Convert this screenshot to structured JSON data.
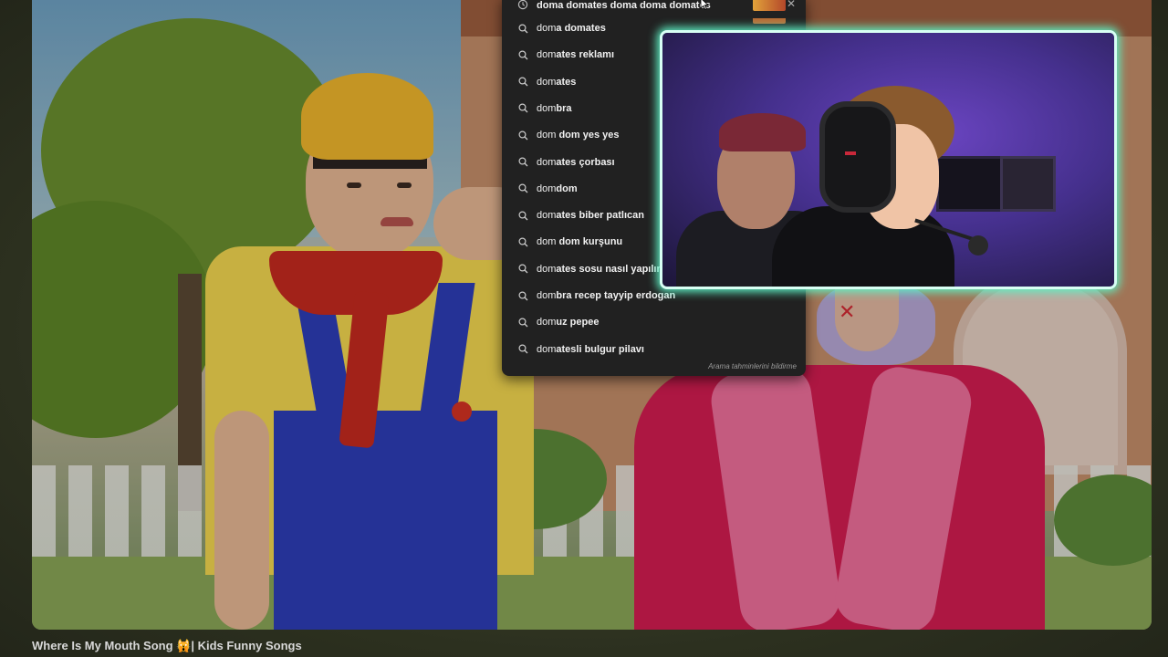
{
  "video": {
    "title": "Where Is My Mouth Song 🙀| Kids Funny Songs"
  },
  "search": {
    "current_query": "doma domates doma doma domates",
    "suggestions": [
      {
        "bold": "dom",
        "rest": "a domates"
      },
      {
        "bold": "dom",
        "rest": "ates reklamı"
      },
      {
        "bold": "dom",
        "rest": "ates"
      },
      {
        "bold": "dom",
        "rest": "bra"
      },
      {
        "bold": "dom",
        "rest": " dom yes yes"
      },
      {
        "bold": "dom",
        "rest": "ates çorbası"
      },
      {
        "bold": "dom",
        "rest": "dom"
      },
      {
        "bold": "dom",
        "rest": "ates biber patlıcan"
      },
      {
        "bold": "dom",
        "rest": " dom kurşunu"
      },
      {
        "bold": "dom",
        "rest": "ates sosu nasıl yapılır"
      },
      {
        "bold": "dom",
        "rest": "bra recep tayyip erdogan"
      },
      {
        "bold": "dom",
        "rest": "uz pepee"
      },
      {
        "bold": "dom",
        "rest": "atesli bulgur pilavı"
      }
    ],
    "report_link": "Arama tahminlerini bildirme",
    "icons": {
      "suggestion": "search-icon",
      "history": "history-icon",
      "close": "close-icon"
    }
  },
  "colors": {
    "dropdown_bg": "#212121",
    "cam_border_glow": "#5ef0c4"
  }
}
